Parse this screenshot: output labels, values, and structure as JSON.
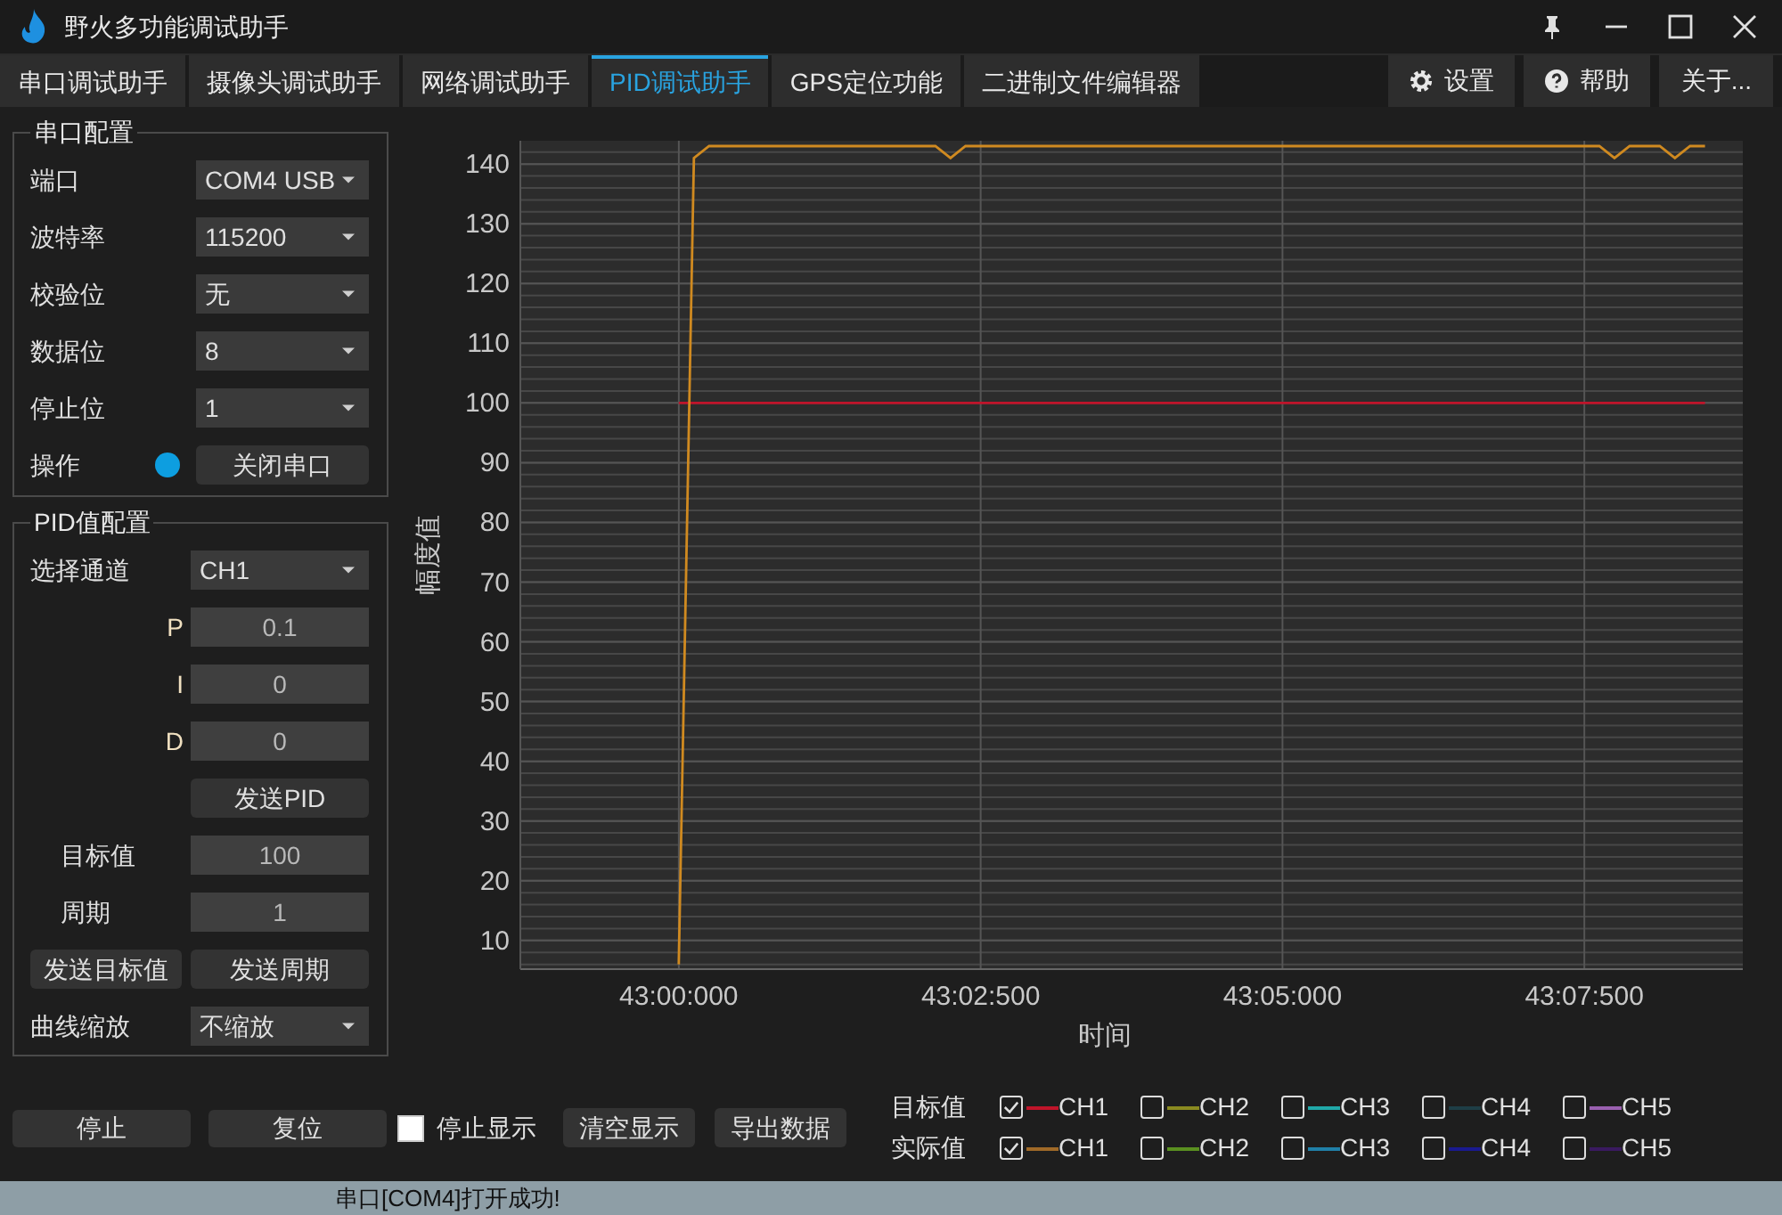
{
  "window": {
    "title": "野火多功能调试助手"
  },
  "tabs": [
    {
      "label": "串口调试助手",
      "selected": false
    },
    {
      "label": "摄像头调试助手",
      "selected": false
    },
    {
      "label": "网络调试助手",
      "selected": false
    },
    {
      "label": "PID调试助手",
      "selected": true
    },
    {
      "label": "GPS定位功能",
      "selected": false
    },
    {
      "label": "二进制文件编辑器",
      "selected": false
    }
  ],
  "toolbar_buttons": [
    {
      "label": "设置",
      "kind": "gear"
    },
    {
      "label": "帮助",
      "kind": "help"
    },
    {
      "label": "关于...",
      "kind": "plain"
    }
  ],
  "serial_config": {
    "title": "串口配置",
    "fields": [
      {
        "label": "端口",
        "value": "COM4 USB"
      },
      {
        "label": "波特率",
        "value": "115200"
      },
      {
        "label": "校验位",
        "value": "无"
      },
      {
        "label": "数据位",
        "value": "8"
      },
      {
        "label": "停止位",
        "value": "1"
      }
    ],
    "operation": {
      "label": "操作",
      "connected": true,
      "button": "关闭串口"
    }
  },
  "pid_config": {
    "title": "PID值配置",
    "channel": {
      "label": "选择通道",
      "value": "CH1"
    },
    "params": [
      {
        "label": "P",
        "value": "0.1"
      },
      {
        "label": "I",
        "value": "0"
      },
      {
        "label": "D",
        "value": "0"
      }
    ],
    "send_pid": "发送PID",
    "target": {
      "label": "目标值",
      "value": "100"
    },
    "period": {
      "label": "周期",
      "value": "1"
    },
    "send_buttons": [
      "发送目标值",
      "发送周期"
    ],
    "zoom": {
      "label": "曲线缩放",
      "value": "不缩放"
    }
  },
  "controls": {
    "buttons": [
      "停止",
      "复位"
    ],
    "stop_display": {
      "label": "停止显示",
      "checked": false
    },
    "actions": [
      "清空显示",
      "导出数据"
    ]
  },
  "legend": [
    {
      "label": "目标值",
      "channels": [
        {
          "name": "CH1",
          "checked": true,
          "color": "#c0142a"
        },
        {
          "name": "CH2",
          "checked": false,
          "color": "#8a8a20"
        },
        {
          "name": "CH3",
          "checked": false,
          "color": "#20a8a8"
        },
        {
          "name": "CH4",
          "checked": false,
          "color": "#1e3e46"
        },
        {
          "name": "CH5",
          "checked": false,
          "color": "#9a60b0"
        }
      ]
    },
    {
      "label": "实际值",
      "channels": [
        {
          "name": "CH1",
          "checked": true,
          "color": "#a06a28"
        },
        {
          "name": "CH2",
          "checked": false,
          "color": "#5a9020"
        },
        {
          "name": "CH3",
          "checked": false,
          "color": "#2080a8"
        },
        {
          "name": "CH4",
          "checked": false,
          "color": "#1a1a90"
        },
        {
          "name": "CH5",
          "checked": false,
          "color": "#3a1a60"
        }
      ]
    }
  ],
  "chart_data": {
    "type": "line",
    "xlabel": "时间",
    "ylabel": "幅度值",
    "categories": [
      null,
      null,
      null,
      null,
      null,
      null,
      null,
      null,
      null,
      null,
      "43:00:000",
      null,
      null,
      null,
      null,
      null,
      null,
      null,
      null,
      null,
      null,
      null,
      null,
      null,
      null,
      null,
      null,
      null,
      null,
      null,
      "43:02:500",
      null,
      null,
      null,
      null,
      null,
      null,
      null,
      null,
      null,
      null,
      null,
      null,
      null,
      null,
      null,
      null,
      null,
      null,
      null,
      "43:05:000",
      null,
      null,
      null,
      null,
      null,
      null,
      null,
      null,
      null,
      null,
      null,
      null,
      null,
      null,
      null,
      null,
      null,
      null,
      null,
      "43:07:500",
      null,
      null,
      null,
      null,
      null,
      null,
      null,
      null,
      null,
      null
    ],
    "series": [
      {
        "color": "#c0142a",
        "values": [
          null,
          null,
          null,
          null,
          null,
          null,
          null,
          null,
          null,
          null,
          100,
          100,
          100,
          100,
          100,
          100,
          100,
          100,
          100,
          100,
          100,
          100,
          100,
          100,
          100,
          100,
          100,
          100,
          100,
          100,
          100,
          100,
          100,
          100,
          100,
          100,
          100,
          100,
          100,
          100,
          100,
          100,
          100,
          100,
          100,
          100,
          100,
          100,
          100,
          100,
          100,
          100,
          100,
          100,
          100,
          100,
          100,
          100,
          100,
          100,
          100,
          100,
          100,
          100,
          100,
          100,
          100,
          100,
          100,
          100,
          100,
          100,
          100,
          100,
          100,
          100,
          100,
          100,
          100,
          null,
          null
        ]
      },
      {
        "color": "#d08a20",
        "values": [
          null,
          null,
          null,
          null,
          null,
          null,
          null,
          null,
          null,
          null,
          6,
          141,
          143,
          143,
          143,
          143,
          143,
          143,
          143,
          143,
          143,
          143,
          143,
          143,
          143,
          143,
          143,
          143,
          141,
          143,
          143,
          143,
          143,
          143,
          143,
          143,
          143,
          143,
          143,
          143,
          143,
          143,
          143,
          143,
          143,
          143,
          143,
          143,
          143,
          143,
          143,
          143,
          143,
          143,
          143,
          143,
          143,
          143,
          143,
          143,
          143,
          143,
          143,
          143,
          143,
          143,
          143,
          143,
          143,
          143,
          143,
          143,
          141,
          143,
          143,
          143,
          141,
          143,
          143,
          null,
          null
        ]
      }
    ],
    "ylim": [
      5.2,
      143.9
    ],
    "grid": true,
    "yticks": [
      10,
      20,
      30,
      40,
      50,
      60,
      70,
      80,
      90,
      100,
      110,
      120,
      130,
      140
    ]
  },
  "status_bar": {
    "message": "串口[COM4]打开成功!"
  }
}
